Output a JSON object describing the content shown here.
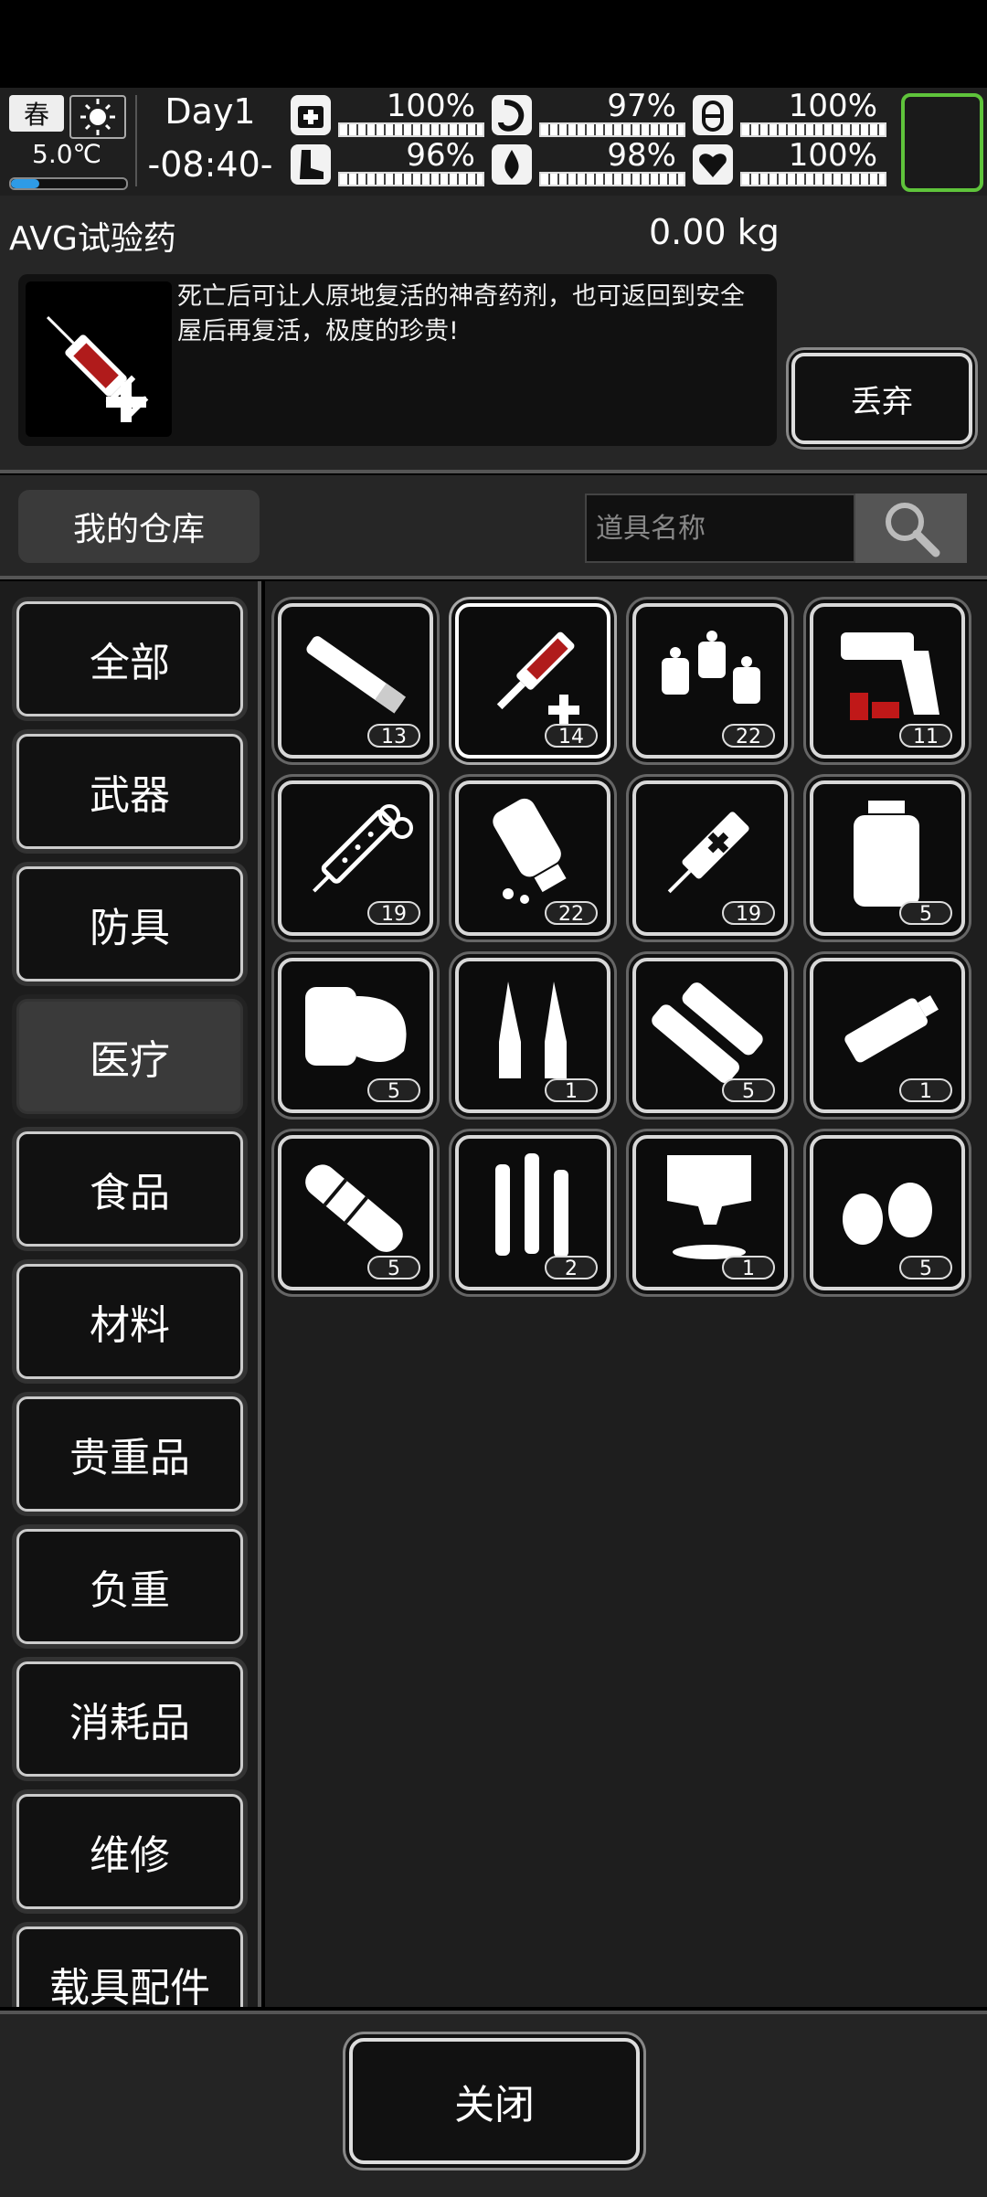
{
  "status": {
    "season": "春",
    "temperature": "5.0℃",
    "temperature_level": 0.25,
    "day": "Day1",
    "time": "-08:40-",
    "stats": [
      {
        "icon": "first-aid-icon",
        "value": "100%"
      },
      {
        "icon": "stomach-icon",
        "value": "97%"
      },
      {
        "icon": "pill-icon",
        "value": "100%"
      },
      {
        "icon": "boot-icon",
        "value": "96%"
      },
      {
        "icon": "water-drop-icon",
        "value": "98%"
      },
      {
        "icon": "heart-icon",
        "value": "100%"
      }
    ]
  },
  "detail": {
    "name": "AVG试验药",
    "weight": "0.00 kg",
    "description": "死亡后可让人原地复活的神奇药剂，也可返回到安全屋后再复活，极度的珍贵!",
    "discard_label": "丢弃"
  },
  "warehouse": {
    "tab_label": "我的仓库",
    "search_placeholder": "道具名称"
  },
  "categories": [
    "全部",
    "武器",
    "防具",
    "医疗",
    "食品",
    "材料",
    "贵重品",
    "负重",
    "消耗品",
    "维修",
    "载具配件"
  ],
  "active_category": "医疗",
  "items": [
    {
      "icon": "cigarette-icon",
      "count": "13"
    },
    {
      "icon": "syringe-plus-icon",
      "count": "14",
      "selected": true
    },
    {
      "icon": "pill-bottles-icon",
      "count": "22"
    },
    {
      "icon": "flare-gun-icon",
      "count": "11"
    },
    {
      "icon": "dotted-syringe-icon",
      "count": "19"
    },
    {
      "icon": "spilled-bottle-icon",
      "count": "22"
    },
    {
      "icon": "cross-syringe-icon",
      "count": "19"
    },
    {
      "icon": "medicine-jar-icon",
      "count": "5"
    },
    {
      "icon": "bandage-roll-icon",
      "count": "5"
    },
    {
      "icon": "ampoules-icon",
      "count": "1"
    },
    {
      "icon": "splint-icon",
      "count": "5"
    },
    {
      "icon": "ointment-tube-icon",
      "count": "1"
    },
    {
      "icon": "tourniquet-icon",
      "count": "5"
    },
    {
      "icon": "test-tubes-icon",
      "count": "2"
    },
    {
      "icon": "powder-pack-icon",
      "count": "1"
    },
    {
      "icon": "seeds-icon",
      "count": "5"
    }
  ],
  "close_label": "关闭"
}
